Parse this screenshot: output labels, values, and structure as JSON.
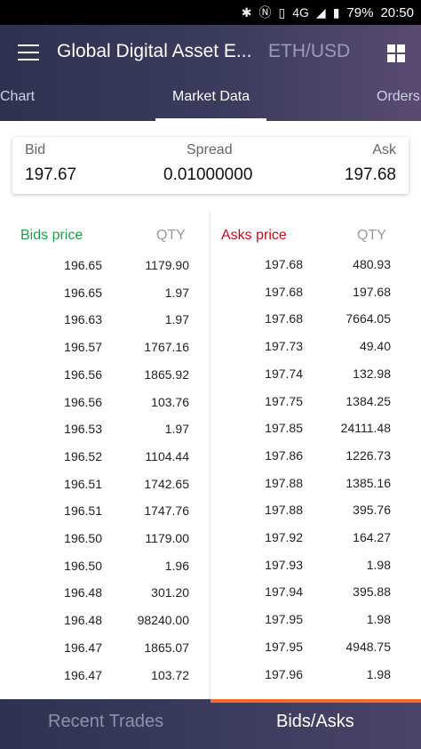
{
  "status": {
    "network": "4G",
    "battery": "79%",
    "time": "20:50"
  },
  "header": {
    "title": "Global Digital Asset E...",
    "pair": "ETH/USD"
  },
  "tabs": [
    "Chart",
    "Market Data",
    "Orders"
  ],
  "spread": {
    "bid_label": "Bid",
    "bid_value": "197.67",
    "spread_label": "Spread",
    "spread_value": "0.01000000",
    "ask_label": "Ask",
    "ask_value": "197.68"
  },
  "book": {
    "bids_header": "Bids price",
    "bids_qty_header": "QTY",
    "asks_header": "Asks price",
    "asks_qty_header": "QTY",
    "bids_color": "#1aa34a",
    "asks_color": "#d0021b",
    "bids": [
      [
        "196.65",
        "1179.90"
      ],
      [
        "196.65",
        "1.97"
      ],
      [
        "196.63",
        "1.97"
      ],
      [
        "196.57",
        "1767.16"
      ],
      [
        "196.56",
        "1865.92"
      ],
      [
        "196.56",
        "103.76"
      ],
      [
        "196.53",
        "1.97"
      ],
      [
        "196.52",
        "1104.44"
      ],
      [
        "196.51",
        "1742.65"
      ],
      [
        "196.51",
        "1747.76"
      ],
      [
        "196.50",
        "1179.00"
      ],
      [
        "196.50",
        "1.96"
      ],
      [
        "196.48",
        "301.20"
      ],
      [
        "196.48",
        "98240.00"
      ],
      [
        "196.47",
        "1865.07"
      ],
      [
        "196.47",
        "103.72"
      ]
    ],
    "asks": [
      [
        "197.68",
        "480.93"
      ],
      [
        "197.68",
        "197.68"
      ],
      [
        "197.68",
        "7664.05"
      ],
      [
        "197.73",
        "49.40"
      ],
      [
        "197.74",
        "132.98"
      ],
      [
        "197.75",
        "1384.25"
      ],
      [
        "197.85",
        "24111.48"
      ],
      [
        "197.86",
        "1226.73"
      ],
      [
        "197.88",
        "1385.16"
      ],
      [
        "197.88",
        "395.76"
      ],
      [
        "197.92",
        "164.27"
      ],
      [
        "197.93",
        "1.98"
      ],
      [
        "197.94",
        "395.88"
      ],
      [
        "197.95",
        "1.98"
      ],
      [
        "197.95",
        "4948.75"
      ],
      [
        "197.96",
        "1.98"
      ]
    ]
  },
  "bottom_tabs": [
    "Recent Trades",
    "Bids/Asks"
  ],
  "colors": {
    "accent": "#f26b21",
    "header_bg": "#2e3250"
  }
}
